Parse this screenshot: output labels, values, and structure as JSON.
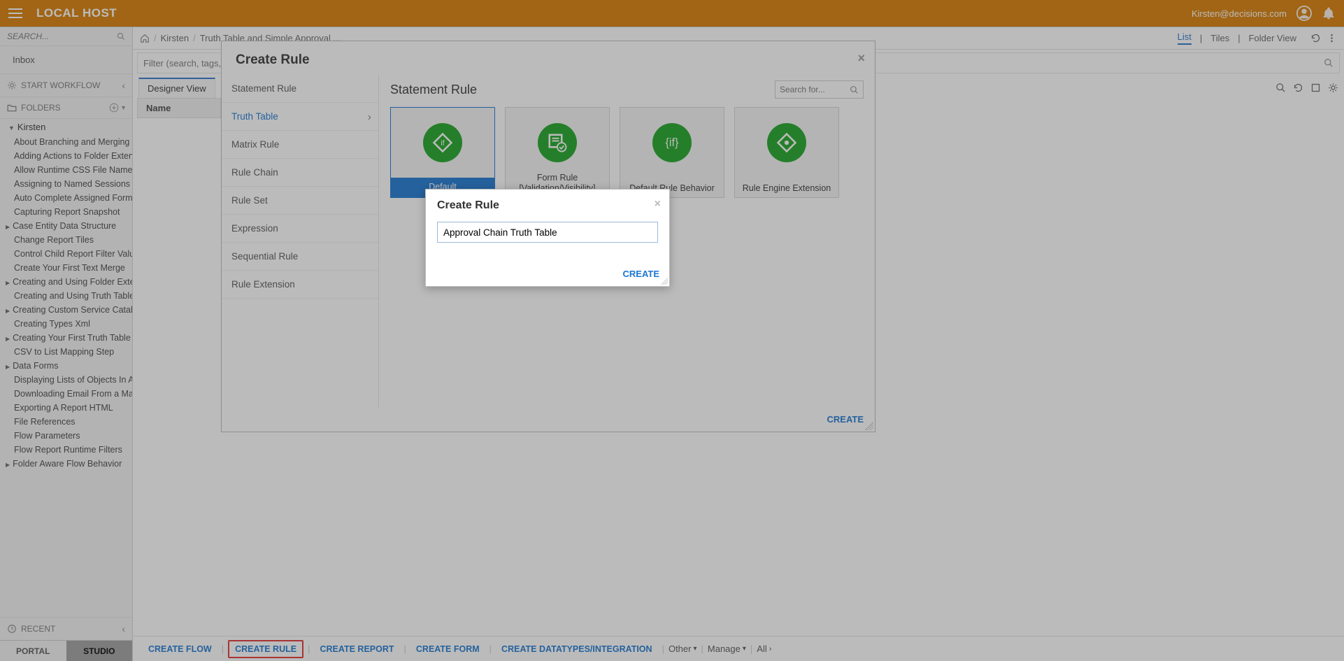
{
  "header": {
    "logo": "LOCAL HOST",
    "user": "Kirsten@decisions.com"
  },
  "sidebar": {
    "search_placeholder": "SEARCH...",
    "inbox": "Inbox",
    "start_workflow": "START WORKFLOW",
    "folders_label": "FOLDERS",
    "root": "Kirsten",
    "items": [
      {
        "label": "About Branching and Merging Fi",
        "expandable": false
      },
      {
        "label": "Adding Actions to Folder Extens",
        "expandable": false
      },
      {
        "label": "Allow Runtime CSS File Name",
        "expandable": false
      },
      {
        "label": "Assigning to Named Sessions",
        "expandable": false
      },
      {
        "label": "Auto Complete Assigned Form",
        "expandable": false
      },
      {
        "label": "Capturing Report Snapshot",
        "expandable": false
      },
      {
        "label": "Case Entity Data Structure",
        "expandable": true
      },
      {
        "label": "Change Report Tiles",
        "expandable": false
      },
      {
        "label": "Control Child Report Filter Value",
        "expandable": false
      },
      {
        "label": "Create Your First Text Merge",
        "expandable": false
      },
      {
        "label": "Creating and Using Folder Exten",
        "expandable": true
      },
      {
        "label": "Creating and Using Truth Tables",
        "expandable": false
      },
      {
        "label": "Creating Custom Service Catalo",
        "expandable": true
      },
      {
        "label": "Creating Types Xml",
        "expandable": false
      },
      {
        "label": "Creating Your First Truth Table",
        "expandable": true
      },
      {
        "label": "CSV to List Mapping Step",
        "expandable": false
      },
      {
        "label": "Data Forms",
        "expandable": true
      },
      {
        "label": "Displaying Lists of Objects In A I",
        "expandable": false
      },
      {
        "label": "Downloading Email From a Mail",
        "expandable": false
      },
      {
        "label": "Exporting A Report HTML",
        "expandable": false
      },
      {
        "label": "File References",
        "expandable": false
      },
      {
        "label": "Flow Parameters",
        "expandable": false
      },
      {
        "label": "Flow Report Runtime Filters",
        "expandable": false
      },
      {
        "label": "Folder Aware Flow Behavior",
        "expandable": true
      }
    ],
    "recent": "RECENT",
    "tabs": {
      "portal": "PORTAL",
      "studio": "STUDIO"
    }
  },
  "breadcrumb": {
    "home": "⌂",
    "p1": "Kirsten",
    "p2": "Truth Table and Simple Approval ...",
    "views": {
      "list": "List",
      "tiles": "Tiles",
      "folder": "Folder View"
    }
  },
  "filter": {
    "placeholder": "Filter (search, tags, types)"
  },
  "designer": {
    "tab": "Designer View",
    "col_name": "Name"
  },
  "bottom": {
    "create_flow": "CREATE FLOW",
    "create_rule": "CREATE RULE",
    "create_report": "CREATE REPORT",
    "create_form": "CREATE FORM",
    "create_datatypes": "CREATE DATATYPES/INTEGRATION",
    "other": "Other",
    "manage": "Manage",
    "all": "All"
  },
  "panel": {
    "title": "Create Rule",
    "search_placeholder": "Search for...",
    "pane_title": "Statement Rule",
    "create_btn": "CREATE",
    "categories": [
      {
        "label": "Statement Rule",
        "active": false
      },
      {
        "label": "Truth Table",
        "active": true
      },
      {
        "label": "Matrix Rule",
        "active": false
      },
      {
        "label": "Rule Chain",
        "active": false
      },
      {
        "label": "Rule Set",
        "active": false
      },
      {
        "label": "Expression",
        "active": false
      },
      {
        "label": "Sequential Rule",
        "active": false
      },
      {
        "label": "Rule Extension",
        "active": false
      }
    ],
    "tiles": [
      {
        "label": "Default",
        "selected": true,
        "icon": "if-diamond"
      },
      {
        "label": "Form Rule [Validation/Visibility]",
        "selected": false,
        "icon": "form-check"
      },
      {
        "label": "Default Rule Behavior",
        "selected": false,
        "icon": "if-braces"
      },
      {
        "label": "Rule Engine Extension",
        "selected": false,
        "icon": "diamond-dot"
      }
    ]
  },
  "modal": {
    "title": "Create Rule",
    "value": "Approval Chain Truth Table",
    "create_btn": "CREATE"
  }
}
